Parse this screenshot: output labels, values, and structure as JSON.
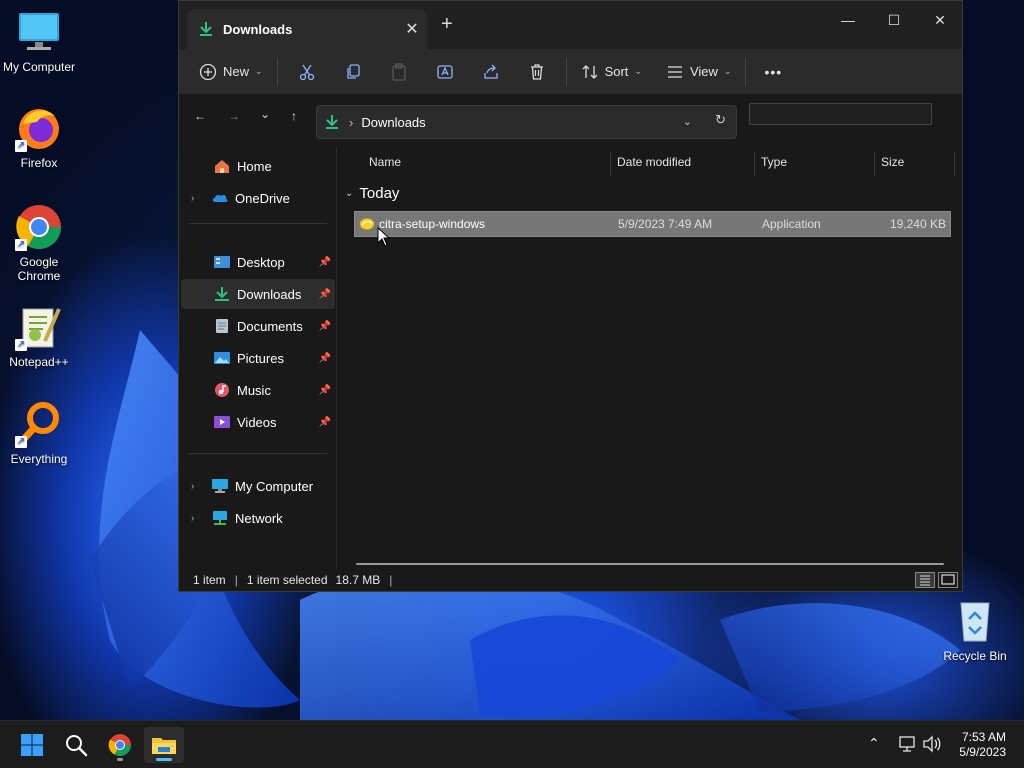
{
  "desktop": {
    "icons": [
      {
        "label": "My Computer",
        "icon": "monitor-icon"
      },
      {
        "label": "Firefox",
        "icon": "firefox-icon"
      },
      {
        "label": "Google Chrome",
        "icon": "chrome-icon"
      },
      {
        "label": "Notepad++",
        "icon": "notepadpp-icon"
      },
      {
        "label": "Everything",
        "icon": "everything-search-icon"
      },
      {
        "label": "Recycle Bin",
        "icon": "recycle-bin-icon"
      }
    ]
  },
  "window": {
    "tab_title": "Downloads",
    "tab_close": "✕",
    "new_tab": "+",
    "controls": {
      "minimize": "—",
      "maximize": "☐",
      "close": "✕"
    },
    "toolbar": {
      "new_label": "New",
      "sort_label": "Sort",
      "view_label": "View",
      "more_label": "•••",
      "chevron": "⌄"
    },
    "address": {
      "crumb_sep": "›",
      "location": "Downloads",
      "dropdown": "⌄",
      "refresh": "↻"
    },
    "nav": {
      "back": "←",
      "forward": "→",
      "recent": "⌄",
      "up": "↑"
    },
    "sidebar": {
      "items": [
        {
          "label": "Home",
          "icon": "home-icon"
        },
        {
          "label": "OneDrive",
          "icon": "onedrive-icon",
          "expandable": true
        },
        {
          "label": "Desktop",
          "icon": "desktop-folder-icon",
          "pinned": true
        },
        {
          "label": "Downloads",
          "icon": "downloads-folder-icon",
          "pinned": true,
          "selected": true
        },
        {
          "label": "Documents",
          "icon": "documents-folder-icon",
          "pinned": true
        },
        {
          "label": "Pictures",
          "icon": "pictures-folder-icon",
          "pinned": true
        },
        {
          "label": "Music",
          "icon": "music-folder-icon",
          "pinned": true
        },
        {
          "label": "Videos",
          "icon": "videos-folder-icon",
          "pinned": true
        },
        {
          "label": "My Computer",
          "icon": "monitor-icon",
          "expandable": true
        },
        {
          "label": "Network",
          "icon": "network-icon",
          "expandable": true
        }
      ],
      "chevron": "›",
      "pin": "📌"
    },
    "columns": {
      "name": "Name",
      "date": "Date modified",
      "type": "Type",
      "size": "Size"
    },
    "group": {
      "label": "Today",
      "chevron": "⌄"
    },
    "files": [
      {
        "name": "citra-setup-windows",
        "date": "5/9/2023 7:49 AM",
        "type": "Application",
        "size": "19,240 KB",
        "selected": true
      }
    ],
    "status": {
      "count": "1 item",
      "selection": "1 item selected",
      "size": "18.7 MB",
      "separator": "|"
    }
  },
  "taskbar": {
    "apps": [
      {
        "name": "start",
        "icon": "windows-start-icon"
      },
      {
        "name": "search",
        "icon": "search-icon"
      },
      {
        "name": "chrome",
        "icon": "chrome-icon"
      },
      {
        "name": "explorer",
        "icon": "file-explorer-icon",
        "active": true
      }
    ],
    "tray": {
      "chevron": "⌃"
    },
    "clock": {
      "time": "7:53 AM",
      "date": "5/9/2023"
    }
  }
}
